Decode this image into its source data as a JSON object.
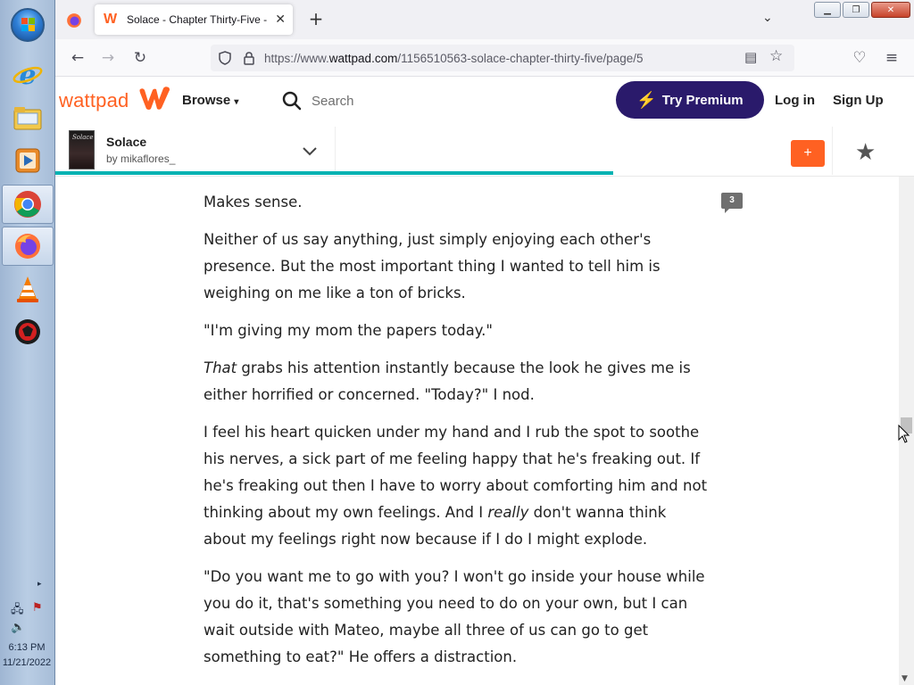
{
  "taskbar": {
    "clock_time": "6:13 PM",
    "clock_date": "11/21/2022"
  },
  "browser": {
    "tab_title": "Solace - Chapter Thirty-Five - P...",
    "url_prefix": "https://www.",
    "url_domain": "wattpad.com",
    "url_path": "/1156510563-solace-chapter-thirty-five/page/5",
    "new_tab_glyph": "+",
    "close_glyph": "✕"
  },
  "wattpad": {
    "logo_text": "wattpad",
    "browse_label": "Browse",
    "search_placeholder": "Search",
    "premium_label": "Try Premium",
    "login_label": "Log in",
    "signup_label": "Sign Up",
    "brand_color": "#ff6122",
    "premium_color": "#2a1a6b"
  },
  "story": {
    "cover_text": "Solace",
    "title": "Solace",
    "author": "by mikaflores_",
    "add_label": "+",
    "reading_progress": 0.65
  },
  "reader": {
    "comment_count": "3",
    "paragraphs": [
      {
        "text": "Makes sense."
      },
      {
        "text": "Neither of us say anything, just simply enjoying each other's presence. But the most important thing I wanted to tell him is weighing on me like a ton of bricks."
      },
      {
        "text": "\"I'm giving my mom the papers today.\""
      },
      {
        "italic": "That",
        "text": " grabs his attention instantly because the look he gives me is either horrified or concerned. \"Today?\" I nod."
      },
      {
        "text_before": "I feel his heart quicken under my hand and I rub the spot to soothe his nerves, a sick part of me feeling happy that he's freaking out. If he's freaking out then I have to worry about comforting him and not thinking about my own feelings. And I ",
        "italic": "really",
        "text_after": " don't wanna think about my feelings right now because if I do I might explode."
      },
      {
        "text": "\"Do you want me to go with you? I won't go inside your house while you do it, that's something you need to do on your own, but I can wait outside with Mateo, maybe all three of us can go to get something to eat?\" He offers a distraction."
      }
    ]
  }
}
